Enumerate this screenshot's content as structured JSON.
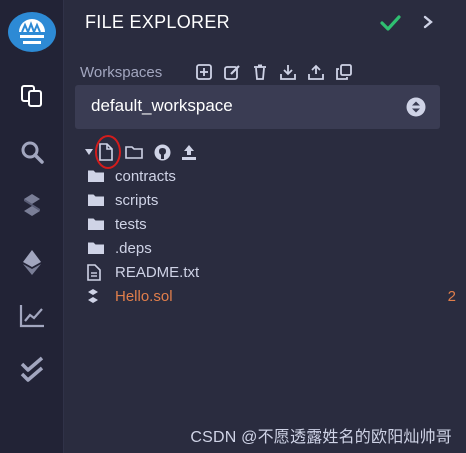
{
  "header": {
    "title": "FILE EXPLORER"
  },
  "workspaces": {
    "label": "Workspaces",
    "selected": "default_workspace"
  },
  "tree": {
    "items": [
      {
        "type": "folder",
        "name": "contracts"
      },
      {
        "type": "folder",
        "name": "scripts"
      },
      {
        "type": "folder",
        "name": "tests"
      },
      {
        "type": "folder",
        "name": ".deps"
      },
      {
        "type": "file",
        "name": "README.txt"
      },
      {
        "type": "solidity",
        "name": "Hello.sol",
        "badge": "2"
      }
    ]
  },
  "watermark": "CSDN @不愿透露姓名的欧阳灿帅哥",
  "colors": {
    "accent_green": "#2fbf71",
    "sol_orange": "#e07e4b",
    "logo_blue": "#2d8ad5",
    "highlight_red": "#d41c1c"
  },
  "icons": {
    "activity": [
      "remix-logo-icon",
      "file-explorer-icon",
      "search-icon",
      "solidity-compiler-icon",
      "deploy-icon",
      "analytics-icon",
      "unit-testing-icon"
    ],
    "workspace_tools": [
      "add-workspace-icon",
      "rename-workspace-icon",
      "delete-workspace-icon",
      "download-workspace-icon",
      "upload-workspace-icon",
      "clone-workspace-icon"
    ],
    "tree_tools": [
      "collapse-caret-icon",
      "new-file-icon",
      "new-folder-icon",
      "github-icon",
      "upload-icon"
    ]
  }
}
